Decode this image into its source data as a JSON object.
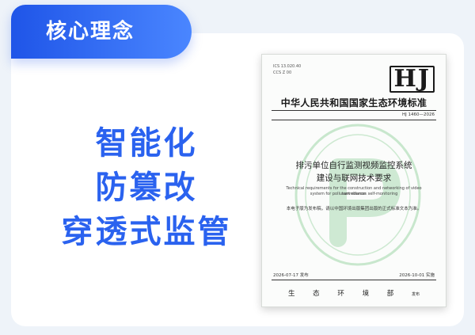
{
  "header": {
    "title": "核心理念"
  },
  "slogan": {
    "line1": "智能化",
    "line2": "防篡改",
    "line3": "穿透式监管"
  },
  "document": {
    "ics": "ICS 13.020.40",
    "ccs": "CCS Z 00",
    "hj": "HJ",
    "org": "中华人民共和国国家生态环境标准",
    "std_no": "HJ 1460—2026",
    "title_line1": "排污单位自行监测视频监控系统",
    "title_line2": "建设与联网技术要求",
    "english_line1": "Technical requirements for the construction and networking of video surveillance",
    "english_line2": "system for pollutant sources self-monitoring",
    "note": "本电子版为发布稿，请以中国环境出版集团出版的正式标准文本为准。",
    "issue_date": "2026-07-17 发布",
    "impl_date": "2026-10-01 实施",
    "issuer": "生 态 环 境 部",
    "issuer_suffix": "发布",
    "seal_color": "#6bbf7a"
  }
}
